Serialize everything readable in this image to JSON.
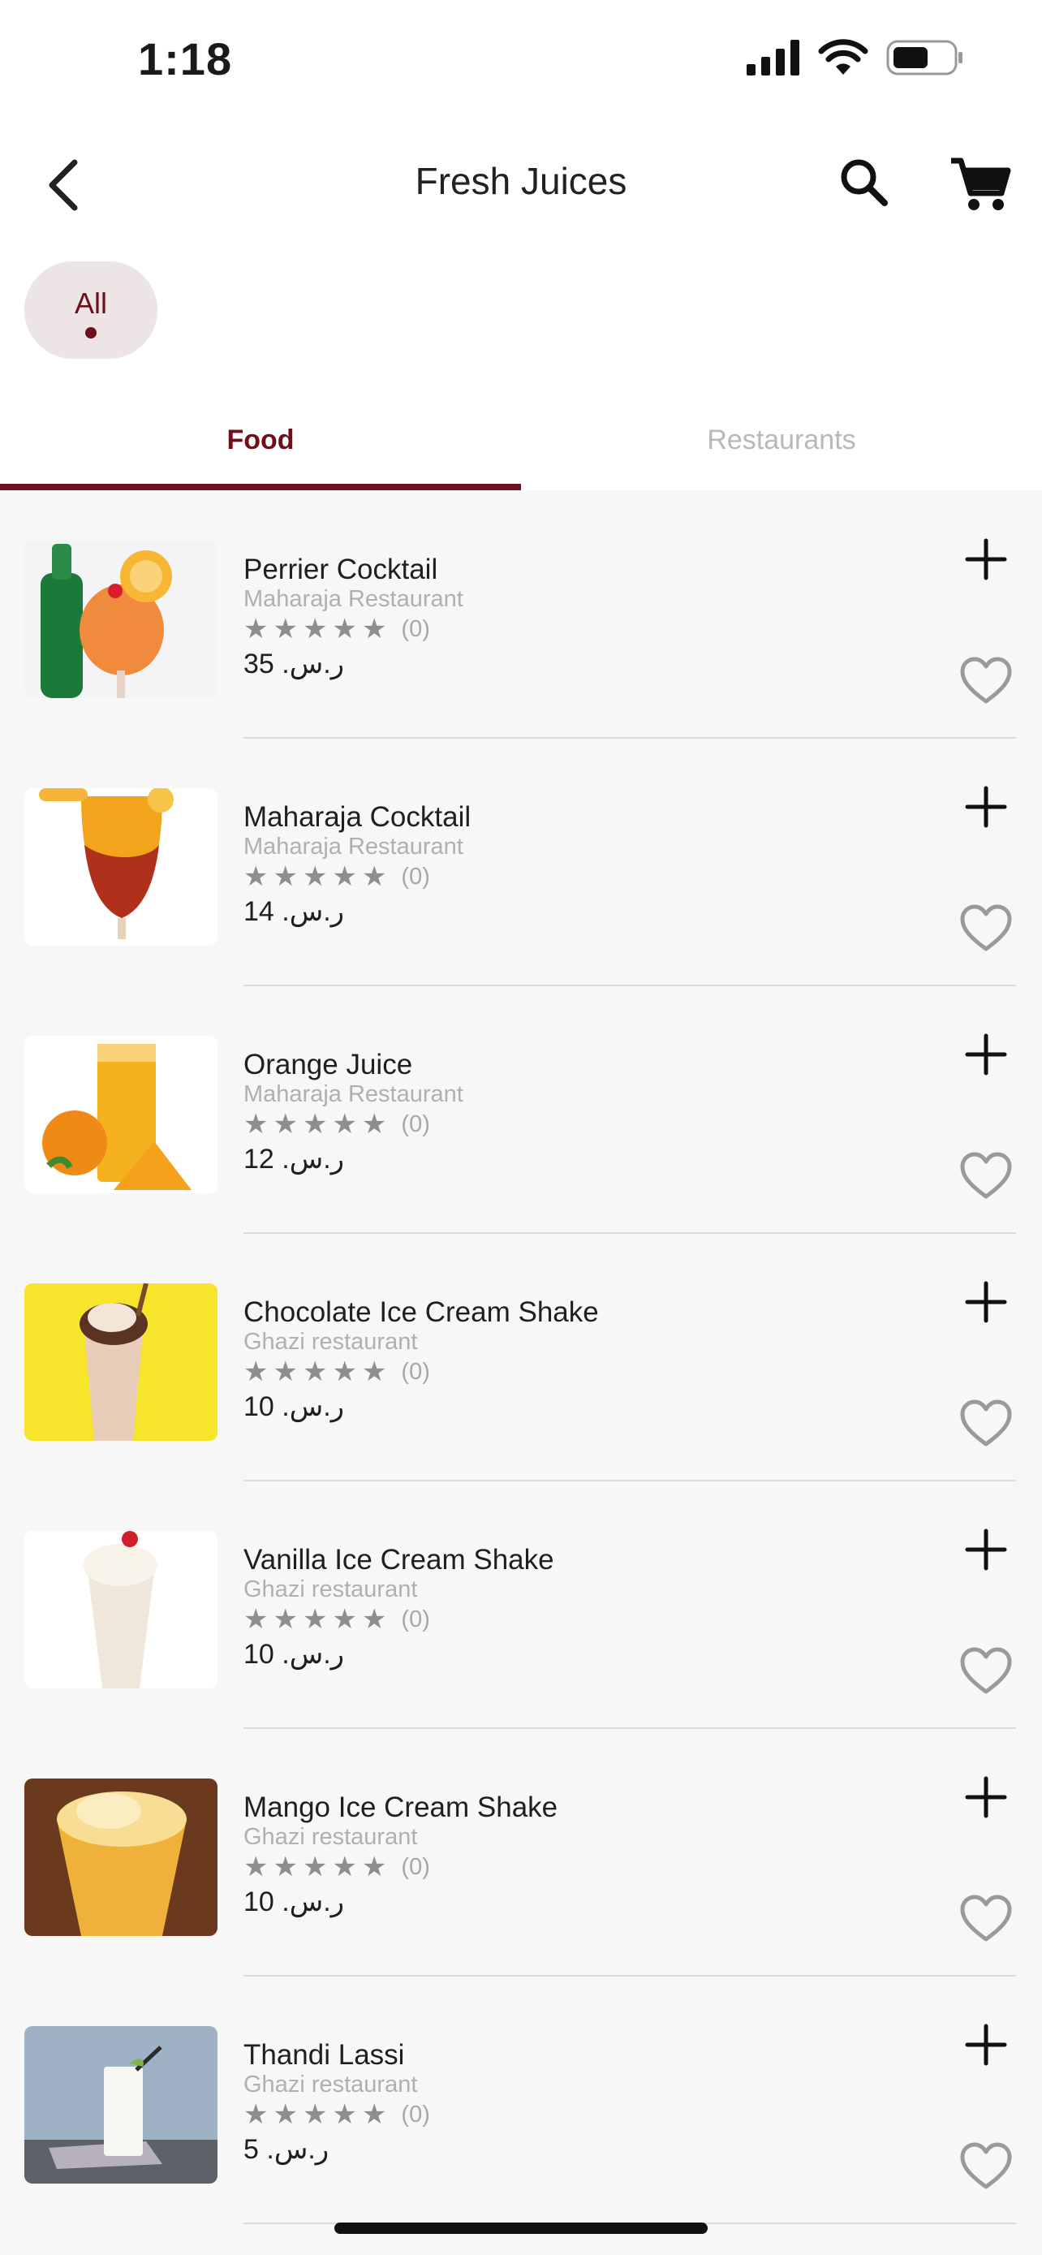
{
  "status": {
    "time": "1:18"
  },
  "header": {
    "title": "Fresh Juices"
  },
  "filter": {
    "chip_label": "All"
  },
  "tabs": [
    {
      "label": "Food",
      "active": true
    },
    {
      "label": "Restaurants",
      "active": false
    }
  ],
  "colors": {
    "accent": "#6e0f1a",
    "chip_bg": "#ece4e5",
    "list_bg": "#f7f7f7"
  },
  "items": [
    {
      "name": "Perrier Cocktail",
      "restaurant": "Maharaja Restaurant",
      "stars": 0,
      "rating_count": "(0)",
      "price": "ر.س. 35"
    },
    {
      "name": "Maharaja Cocktail",
      "restaurant": "Maharaja Restaurant",
      "stars": 0,
      "rating_count": "(0)",
      "price": "ر.س. 14"
    },
    {
      "name": "Orange Juice",
      "restaurant": "Maharaja Restaurant",
      "stars": 0,
      "rating_count": "(0)",
      "price": "ر.س. 12"
    },
    {
      "name": "Chocolate Ice Cream Shake",
      "restaurant": "Ghazi restaurant",
      "stars": 0,
      "rating_count": "(0)",
      "price": "ر.س. 10"
    },
    {
      "name": "Vanilla Ice Cream Shake",
      "restaurant": "Ghazi restaurant",
      "stars": 0,
      "rating_count": "(0)",
      "price": "ر.س. 10"
    },
    {
      "name": "Mango Ice Cream Shake",
      "restaurant": "Ghazi restaurant",
      "stars": 0,
      "rating_count": "(0)",
      "price": "ر.س. 10"
    },
    {
      "name": "Thandi Lassi",
      "restaurant": "Ghazi restaurant",
      "stars": 0,
      "rating_count": "(0)",
      "price": "ر.س. 5"
    }
  ],
  "icons": {
    "back": "chevron-left-icon",
    "search": "search-icon",
    "cart": "cart-icon",
    "add": "plus-icon",
    "favorite": "heart-outline-icon",
    "star": "star-icon"
  }
}
